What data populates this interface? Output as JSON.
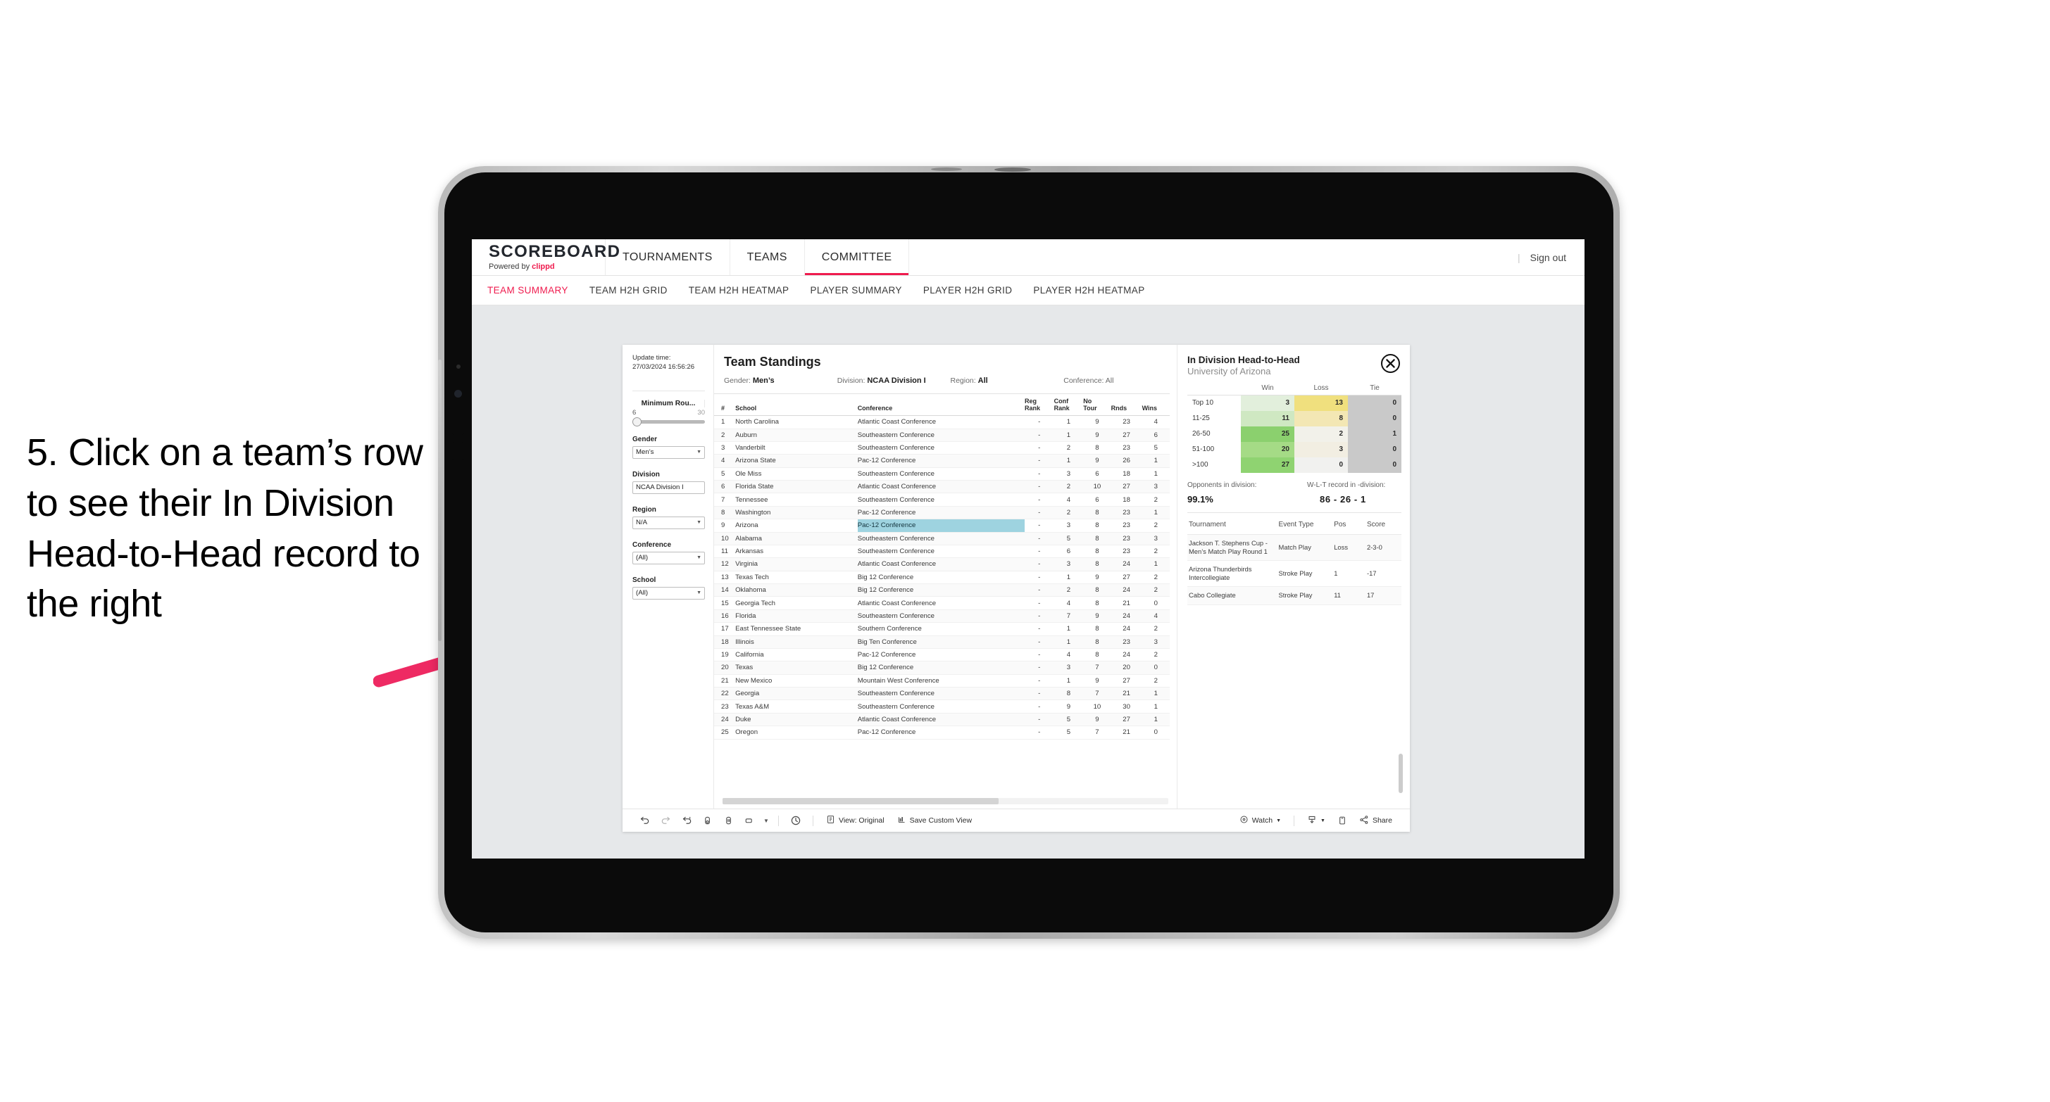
{
  "instruction": {
    "text": "5. Click on a team’s row to see their In Division Head-to-Head record to the right"
  },
  "colors": {
    "accent": "#ef1b4e",
    "arrow": "#ee2a63",
    "selected_cell": "#9ed3e0",
    "win_scale": "#7fcc63",
    "loss_scale": "#ecd862",
    "tie_scale": "#c9c9c9"
  },
  "topnav": {
    "brand_name": "SCOREBOARD",
    "brand_sub_prefix": "Powered by ",
    "brand_sub_accent": "clippd",
    "items": [
      {
        "label": "TOURNAMENTS",
        "active": false
      },
      {
        "label": "TEAMS",
        "active": false
      },
      {
        "label": "COMMITTEE",
        "active": true
      }
    ],
    "separator": "|",
    "signout": "Sign out"
  },
  "subnav": {
    "items": [
      {
        "label": "TEAM SUMMARY",
        "active": true
      },
      {
        "label": "TEAM H2H GRID",
        "active": false
      },
      {
        "label": "TEAM H2H HEATMAP",
        "active": false
      },
      {
        "label": "PLAYER SUMMARY",
        "active": false
      },
      {
        "label": "PLAYER H2H GRID",
        "active": false
      },
      {
        "label": "PLAYER H2H HEATMAP",
        "active": false
      }
    ]
  },
  "filters": {
    "update_label": "Update time:",
    "update_value": "27/03/2024 16:56:26",
    "slider": {
      "label": "Minimum Rou...",
      "min": "6",
      "max": "30",
      "value_pct": 3
    },
    "groups": [
      {
        "label": "Gender",
        "value": "Men’s"
      },
      {
        "label": "Division",
        "value": "NCAA Division I"
      },
      {
        "label": "Region",
        "value": "N/A"
      },
      {
        "label": "Conference",
        "value": "(All)"
      },
      {
        "label": "School",
        "value": "(All)"
      }
    ]
  },
  "standings": {
    "title": "Team Standings",
    "filter_summary": [
      {
        "key": "Gender:",
        "value": "Men’s"
      },
      {
        "key": "Division:",
        "value": "NCAA Division I"
      },
      {
        "key": "Region:",
        "value": "All"
      },
      {
        "key": "Conference:",
        "value": "All"
      }
    ],
    "columns": [
      "#",
      "School",
      "Conference",
      "Reg Rank",
      "Conf Rank",
      "No Tour",
      "Rnds",
      "Wins"
    ],
    "columns_wrapped": [
      {
        "l1": "#",
        "l2": ""
      },
      {
        "l1": "School",
        "l2": ""
      },
      {
        "l1": "Conference",
        "l2": ""
      },
      {
        "l1": "Reg",
        "l2": "Rank"
      },
      {
        "l1": "Conf",
        "l2": "Rank"
      },
      {
        "l1": "No",
        "l2": "Tour"
      },
      {
        "l1": "Rnds",
        "l2": ""
      },
      {
        "l1": "Wins",
        "l2": ""
      }
    ],
    "selected_rank": 9,
    "rows": [
      {
        "rank": "1",
        "school": "North Carolina",
        "conference": "Atlantic Coast Conference",
        "reg": "-",
        "conf": "1",
        "notour": "9",
        "rnds": "23",
        "wins": "4"
      },
      {
        "rank": "2",
        "school": "Auburn",
        "conference": "Southeastern Conference",
        "reg": "-",
        "conf": "1",
        "notour": "9",
        "rnds": "27",
        "wins": "6"
      },
      {
        "rank": "3",
        "school": "Vanderbilt",
        "conference": "Southeastern Conference",
        "reg": "-",
        "conf": "2",
        "notour": "8",
        "rnds": "23",
        "wins": "5"
      },
      {
        "rank": "4",
        "school": "Arizona State",
        "conference": "Pac-12 Conference",
        "reg": "-",
        "conf": "1",
        "notour": "9",
        "rnds": "26",
        "wins": "1"
      },
      {
        "rank": "5",
        "school": "Ole Miss",
        "conference": "Southeastern Conference",
        "reg": "-",
        "conf": "3",
        "notour": "6",
        "rnds": "18",
        "wins": "1"
      },
      {
        "rank": "6",
        "school": "Florida State",
        "conference": "Atlantic Coast Conference",
        "reg": "-",
        "conf": "2",
        "notour": "10",
        "rnds": "27",
        "wins": "3"
      },
      {
        "rank": "7",
        "school": "Tennessee",
        "conference": "Southeastern Conference",
        "reg": "-",
        "conf": "4",
        "notour": "6",
        "rnds": "18",
        "wins": "2"
      },
      {
        "rank": "8",
        "school": "Washington",
        "conference": "Pac-12 Conference",
        "reg": "-",
        "conf": "2",
        "notour": "8",
        "rnds": "23",
        "wins": "1"
      },
      {
        "rank": "9",
        "school": "Arizona",
        "conference": "Pac-12 Conference",
        "reg": "-",
        "conf": "3",
        "notour": "8",
        "rnds": "23",
        "wins": "2"
      },
      {
        "rank": "10",
        "school": "Alabama",
        "conference": "Southeastern Conference",
        "reg": "-",
        "conf": "5",
        "notour": "8",
        "rnds": "23",
        "wins": "3"
      },
      {
        "rank": "11",
        "school": "Arkansas",
        "conference": "Southeastern Conference",
        "reg": "-",
        "conf": "6",
        "notour": "8",
        "rnds": "23",
        "wins": "2"
      },
      {
        "rank": "12",
        "school": "Virginia",
        "conference": "Atlantic Coast Conference",
        "reg": "-",
        "conf": "3",
        "notour": "8",
        "rnds": "24",
        "wins": "1"
      },
      {
        "rank": "13",
        "school": "Texas Tech",
        "conference": "Big 12 Conference",
        "reg": "-",
        "conf": "1",
        "notour": "9",
        "rnds": "27",
        "wins": "2"
      },
      {
        "rank": "14",
        "school": "Oklahoma",
        "conference": "Big 12 Conference",
        "reg": "-",
        "conf": "2",
        "notour": "8",
        "rnds": "24",
        "wins": "2"
      },
      {
        "rank": "15",
        "school": "Georgia Tech",
        "conference": "Atlantic Coast Conference",
        "reg": "-",
        "conf": "4",
        "notour": "8",
        "rnds": "21",
        "wins": "0"
      },
      {
        "rank": "16",
        "school": "Florida",
        "conference": "Southeastern Conference",
        "reg": "-",
        "conf": "7",
        "notour": "9",
        "rnds": "24",
        "wins": "4"
      },
      {
        "rank": "17",
        "school": "East Tennessee State",
        "conference": "Southern Conference",
        "reg": "-",
        "conf": "1",
        "notour": "8",
        "rnds": "24",
        "wins": "2"
      },
      {
        "rank": "18",
        "school": "Illinois",
        "conference": "Big Ten Conference",
        "reg": "-",
        "conf": "1",
        "notour": "8",
        "rnds": "23",
        "wins": "3"
      },
      {
        "rank": "19",
        "school": "California",
        "conference": "Pac-12 Conference",
        "reg": "-",
        "conf": "4",
        "notour": "8",
        "rnds": "24",
        "wins": "2"
      },
      {
        "rank": "20",
        "school": "Texas",
        "conference": "Big 12 Conference",
        "reg": "-",
        "conf": "3",
        "notour": "7",
        "rnds": "20",
        "wins": "0"
      },
      {
        "rank": "21",
        "school": "New Mexico",
        "conference": "Mountain West Conference",
        "reg": "-",
        "conf": "1",
        "notour": "9",
        "rnds": "27",
        "wins": "2"
      },
      {
        "rank": "22",
        "school": "Georgia",
        "conference": "Southeastern Conference",
        "reg": "-",
        "conf": "8",
        "notour": "7",
        "rnds": "21",
        "wins": "1"
      },
      {
        "rank": "23",
        "school": "Texas A&M",
        "conference": "Southeastern Conference",
        "reg": "-",
        "conf": "9",
        "notour": "10",
        "rnds": "30",
        "wins": "1"
      },
      {
        "rank": "24",
        "school": "Duke",
        "conference": "Atlantic Coast Conference",
        "reg": "-",
        "conf": "5",
        "notour": "9",
        "rnds": "27",
        "wins": "1"
      },
      {
        "rank": "25",
        "school": "Oregon",
        "conference": "Pac-12 Conference",
        "reg": "-",
        "conf": "5",
        "notour": "7",
        "rnds": "21",
        "wins": "0"
      }
    ]
  },
  "h2h": {
    "title": "In Division Head-to-Head",
    "subtitle": "University of Arizona",
    "close_icon": "close-icon",
    "columns": [
      "",
      "Win",
      "Loss",
      "Tie"
    ],
    "rows": [
      {
        "bucket": "Top 10",
        "win": "3",
        "loss": "13",
        "tie": "0",
        "win_shade": "#e2efdc",
        "loss_shade": "#f0e07e",
        "tie_shade": "#c9c9c9"
      },
      {
        "bucket": "11-25",
        "win": "11",
        "loss": "8",
        "tie": "0",
        "win_shade": "#cfe8c2",
        "loss_shade": "#f3e7b4",
        "tie_shade": "#c9c9c9"
      },
      {
        "bucket": "26-50",
        "win": "25",
        "loss": "2",
        "tie": "1",
        "win_shade": "#8bd06e",
        "loss_shade": "#f2f1ea",
        "tie_shade": "#c9c9c9"
      },
      {
        "bucket": "51-100",
        "win": "20",
        "loss": "3",
        "tie": "0",
        "win_shade": "#a5db86",
        "loss_shade": "#f2eee2",
        "tie_shade": "#c9c9c9"
      },
      {
        "bucket": ">100",
        "win": "27",
        "loss": "0",
        "tie": "0",
        "win_shade": "#8fd371",
        "loss_shade": "#f1f1ef",
        "tie_shade": "#c9c9c9"
      }
    ],
    "stats": [
      {
        "key": "Opponents in division:",
        "value": "99.1%"
      },
      {
        "key": "W-L-T record in -division:",
        "value": "86 - 26 - 1"
      }
    ],
    "tournament_columns": [
      "Tournament",
      "Event Type",
      "Pos",
      "Score"
    ],
    "tournaments": [
      {
        "name": "Jackson T. Stephens Cup - Men’s Match Play Round 1",
        "type": "Match Play",
        "pos": "Loss",
        "score": "2-3-0"
      },
      {
        "name": "Arizona Thunderbirds Intercollegiate",
        "type": "Stroke Play",
        "pos": "1",
        "score": "-17"
      },
      {
        "name": "Cabo Collegiate",
        "type": "Stroke Play",
        "pos": "11",
        "score": "17"
      }
    ]
  },
  "toolbar": {
    "icons": [
      "undo-icon",
      "redo-icon",
      "revert-icon",
      "refresh-data-icon",
      "pause-icon",
      "rect-select-icon",
      "dropdown-caret-icon"
    ],
    "clock_icon": "history-icon",
    "view_label": "View: Original",
    "save_label": "Save Custom View",
    "watch_label": "Watch",
    "share_label": "Share",
    "download_icon": "download-icon",
    "device_icon": "device-icon",
    "share_icon": "share-icon",
    "watch_icon": "watch-icon",
    "view_icon": "view-icon",
    "save_icon": "save-icon"
  }
}
